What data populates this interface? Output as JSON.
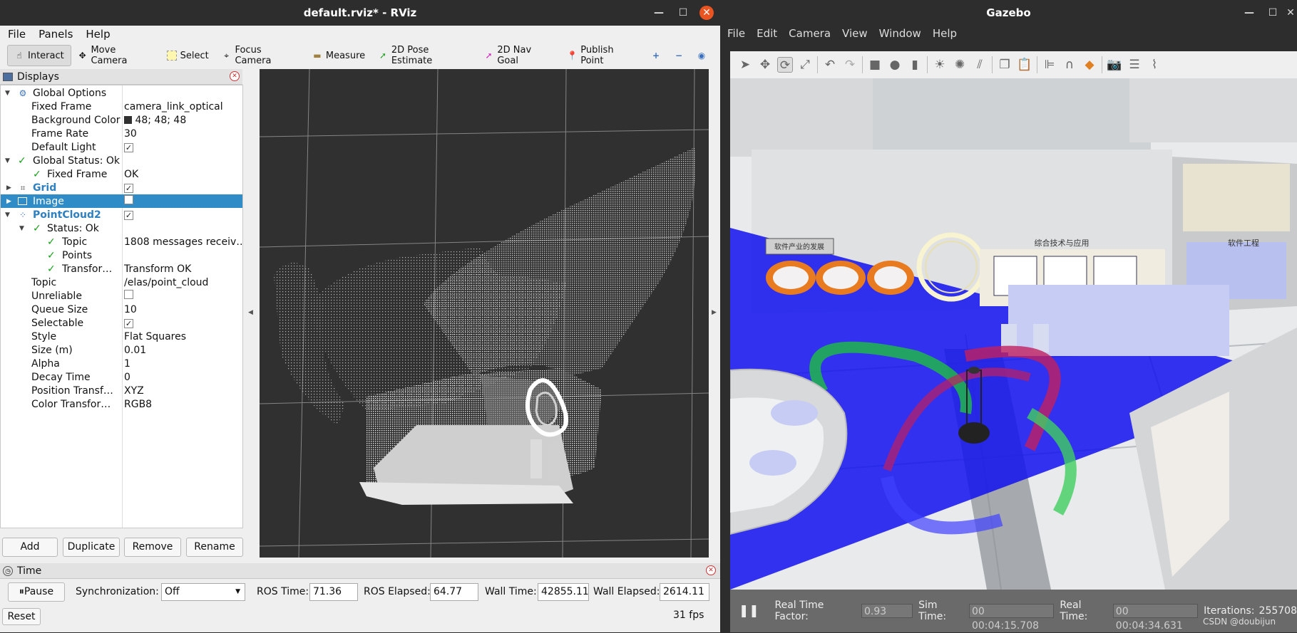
{
  "rviz": {
    "title": "default.rviz* - RViz",
    "menu": [
      "File",
      "Panels",
      "Help"
    ],
    "tools": [
      {
        "label": "Interact",
        "icon": "cursor-icon"
      },
      {
        "label": "Move Camera",
        "icon": "move-camera-icon"
      },
      {
        "label": "Select",
        "icon": "select-icon"
      },
      {
        "label": "Focus Camera",
        "icon": "focus-camera-icon"
      },
      {
        "label": "Measure",
        "icon": "measure-icon"
      },
      {
        "label": "2D Pose Estimate",
        "icon": "pose-estimate-icon"
      },
      {
        "label": "2D Nav Goal",
        "icon": "nav-goal-icon"
      },
      {
        "label": "Publish Point",
        "icon": "publish-point-icon"
      }
    ],
    "displays": {
      "header": "Displays",
      "rows": [
        {
          "label": "Global Options",
          "value": ""
        },
        {
          "label": "Fixed Frame",
          "value": "camera_link_optical"
        },
        {
          "label": "Background Color",
          "value": "48; 48; 48"
        },
        {
          "label": "Frame Rate",
          "value": "30"
        },
        {
          "label": "Default Light",
          "value": ""
        },
        {
          "label": "Global Status: Ok",
          "value": ""
        },
        {
          "label": "Fixed Frame",
          "value": "OK"
        },
        {
          "label": "Grid",
          "value": ""
        },
        {
          "label": "Image",
          "value": ""
        },
        {
          "label": "PointCloud2",
          "value": ""
        },
        {
          "label": "Status: Ok",
          "value": ""
        },
        {
          "label": "Topic",
          "value": "1808 messages receiv…"
        },
        {
          "label": "Points",
          "value": ""
        },
        {
          "label": "Transfor…",
          "value": "Transform OK"
        },
        {
          "label": "Topic",
          "value": "/elas/point_cloud"
        },
        {
          "label": "Unreliable",
          "value": ""
        },
        {
          "label": "Queue Size",
          "value": "10"
        },
        {
          "label": "Selectable",
          "value": ""
        },
        {
          "label": "Style",
          "value": "Flat Squares"
        },
        {
          "label": "Size (m)",
          "value": "0.01"
        },
        {
          "label": "Alpha",
          "value": "1"
        },
        {
          "label": "Decay Time",
          "value": "0"
        },
        {
          "label": "Position Transf…",
          "value": "XYZ"
        },
        {
          "label": "Color Transfor…",
          "value": "RGB8"
        }
      ],
      "buttons": [
        "Add",
        "Duplicate",
        "Remove",
        "Rename"
      ]
    },
    "time": {
      "header": "Time",
      "pause": "Pause",
      "sync_label": "Synchronization:",
      "sync_value": "Off",
      "ros_time_label": "ROS Time:",
      "ros_time": "71.36",
      "ros_elapsed_label": "ROS Elapsed:",
      "ros_elapsed": "64.77",
      "wall_time_label": "Wall Time:",
      "wall_time": "42855.11",
      "wall_elapsed_label": "Wall Elapsed:",
      "wall_elapsed": "2614.11",
      "reset": "Reset",
      "fps": "31 fps"
    }
  },
  "gazebo": {
    "title": "Gazebo",
    "menu": [
      "File",
      "Edit",
      "Camera",
      "View",
      "Window",
      "Help"
    ],
    "scene_texts": {
      "sign_left": "软件产业的发展",
      "sign_mid": "综合技术与应用",
      "sign_right": "软件工程"
    },
    "status": {
      "rtf_label": "Real Time Factor:",
      "rtf": "0.93",
      "sim_label": "Sim Time:",
      "sim": "00 00:04:15.708",
      "real_label": "Real Time:",
      "real": "00 00:04:34.631",
      "iter_label": "Iterations:",
      "iter": "255708"
    },
    "watermark": "CSDN @doubijun"
  }
}
